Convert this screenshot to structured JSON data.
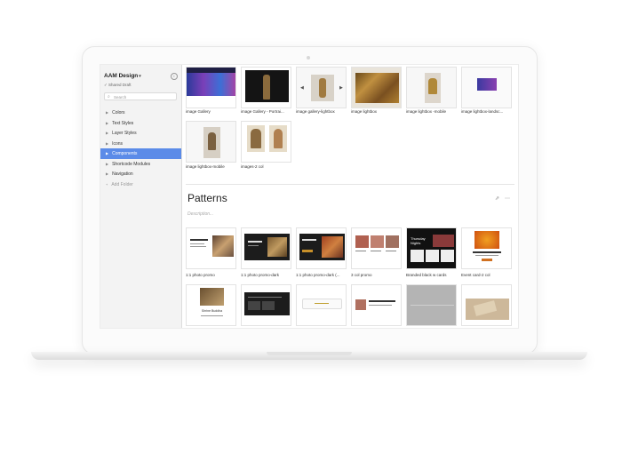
{
  "sidebar": {
    "title": "AAM Design",
    "subtitle": "Shared Draft",
    "search_placeholder": "Search",
    "items": [
      {
        "label": "Colors"
      },
      {
        "label": "Text Styles"
      },
      {
        "label": "Layer Styles"
      },
      {
        "label": "Icons"
      },
      {
        "label": "Components",
        "active": true
      },
      {
        "label": "Shortcode Modules"
      },
      {
        "label": "Navigation"
      },
      {
        "label": "Add Folder"
      }
    ]
  },
  "components": [
    {
      "caption": "image Gallery"
    },
    {
      "caption": "image Gallery - Portrai..."
    },
    {
      "caption": "image gallery-lightbox"
    },
    {
      "caption": "image lightbox"
    },
    {
      "caption": "image lightbox -mobile"
    },
    {
      "caption": "image lightbox-landsc..."
    },
    {
      "caption": "image lightbox-mobile"
    },
    {
      "caption": "images-2 col"
    }
  ],
  "patterns": {
    "title": "Patterns",
    "description": "Description...",
    "items": [
      {
        "caption": "1:1 photo promo"
      },
      {
        "caption": "1:1 photo promo-dark"
      },
      {
        "caption": "1:1 photo promo-dark (..."
      },
      {
        "caption": "3 col promo"
      },
      {
        "caption": "Branded black w cards"
      },
      {
        "caption": "Event card-2 col"
      }
    ]
  },
  "thumb_text": {
    "thursday": "Thursday Nights",
    "shrine": "Shrine Buddha"
  },
  "colors": {
    "accent": "#5b8be8"
  }
}
